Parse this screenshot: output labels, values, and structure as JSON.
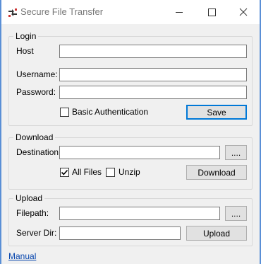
{
  "window": {
    "title": "Secure File Transfer"
  },
  "login": {
    "legend": "Login",
    "host_label": "Host",
    "host_value": "",
    "username_label": "Username:",
    "username_value": "",
    "password_label": "Password:",
    "password_value": "",
    "basic_auth_label": "Basic Authentication",
    "basic_auth_checked": false,
    "save_label": "Save"
  },
  "download": {
    "legend": "Download",
    "destination_label": "Destination:",
    "destination_value": "",
    "browse_label": "....",
    "all_files_label": "All Files",
    "all_files_checked": true,
    "unzip_label": "Unzip",
    "unzip_checked": false,
    "download_label": "Download"
  },
  "upload": {
    "legend": "Upload",
    "filepath_label": "Filepath:",
    "filepath_value": "",
    "browse_label": "....",
    "server_dir_label": "Server Dir:",
    "server_dir_value": "",
    "upload_label": "Upload"
  },
  "footer": {
    "manual_link": "Manual"
  },
  "colors": {
    "default_button_border": "#0078d7",
    "link": "#0645ad",
    "desktop": "#5a8fd6"
  }
}
